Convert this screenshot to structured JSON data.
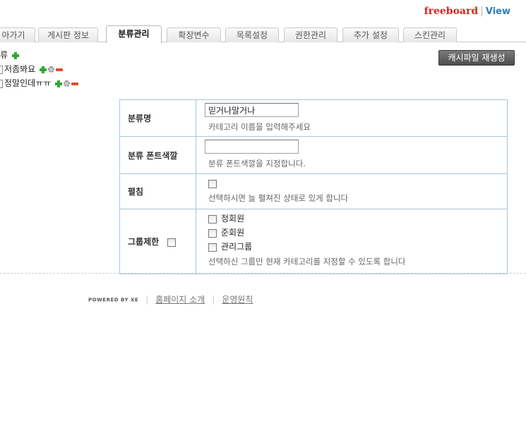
{
  "brand": {
    "name": "freeboard",
    "separator": "|",
    "view": "View"
  },
  "tabs": [
    {
      "label": "아가기",
      "active": false
    },
    {
      "label": "게시판 정보",
      "active": false
    },
    {
      "label": "분류관리",
      "active": true
    },
    {
      "label": "확장변수",
      "active": false
    },
    {
      "label": "목록설정",
      "active": false
    },
    {
      "label": "권한관리",
      "active": false
    },
    {
      "label": "추가 설정",
      "active": false
    },
    {
      "label": "스킨관리",
      "active": false
    }
  ],
  "cache_button": "캐시파일 재생성",
  "tree": {
    "root_label": "류",
    "items": [
      {
        "label": "저좀봐요"
      },
      {
        "label": "정말인데ㅠㅠ"
      }
    ]
  },
  "form": {
    "name": {
      "label": "분류명",
      "value": "믿거나말거나",
      "help": "카테고리 이름을 입력해주세요"
    },
    "font_color": {
      "label": "분류 폰트색깔",
      "value": "",
      "help": "분류 폰트색깔을 지정합니다."
    },
    "expand": {
      "label": "펼침",
      "help": "선택하시면 늘 펼쳐진 상태로 있게 합니다"
    },
    "group": {
      "label": "그룹제한",
      "options": [
        "정회원",
        "준회원",
        "관리그룹"
      ],
      "help": "선택하신 그룹만 현재 카테고리를 지정할 수 있도록 합니다"
    }
  },
  "footer": {
    "powered": "POWERED BY XE",
    "links": [
      "홈페이지 소개",
      "운영원칙"
    ]
  }
}
